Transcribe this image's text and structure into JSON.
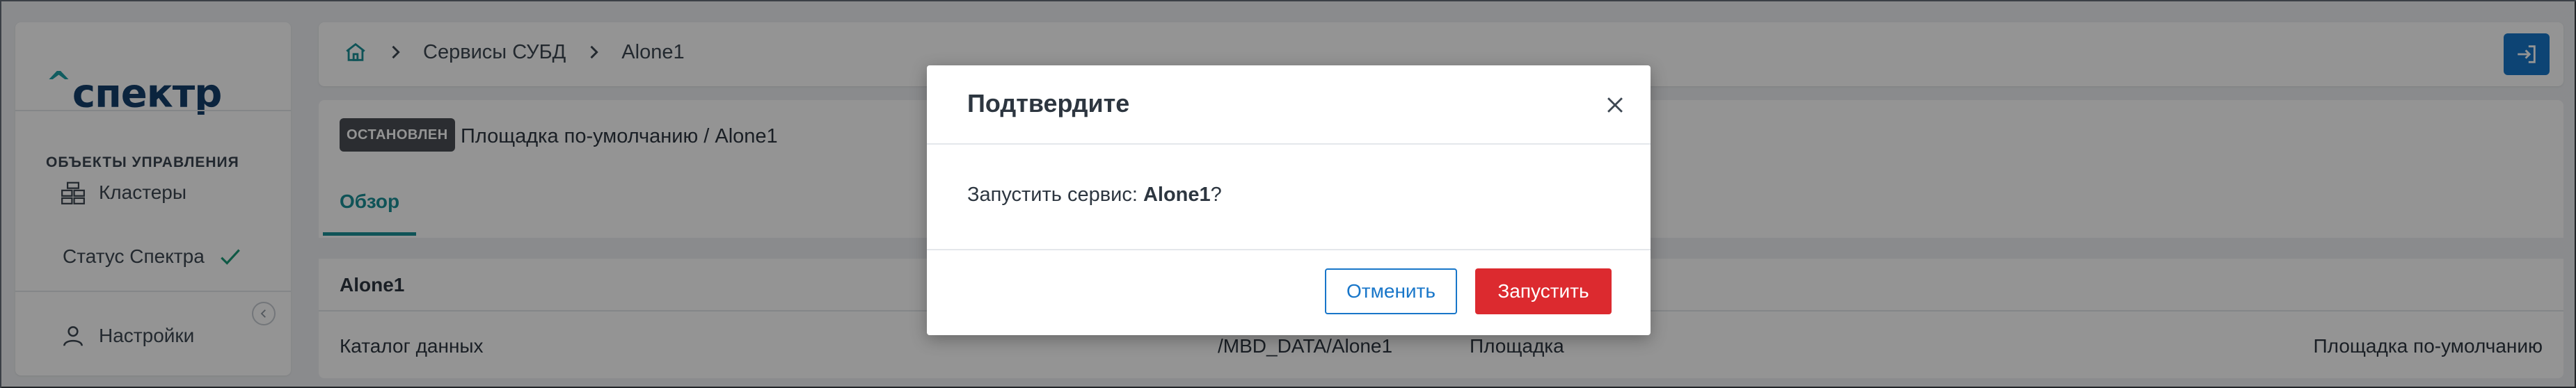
{
  "sidebar": {
    "logo_text": "спектр",
    "logo_mark": "^",
    "section_title": "ОБЪЕКТЫ УПРАВЛЕНИЯ",
    "items": [
      {
        "label": "Кластеры",
        "icon": "clusters-icon"
      },
      {
        "label": "Статус Спектра",
        "icon": "check-icon"
      },
      {
        "label": "Настройки",
        "icon": "user-icon"
      }
    ],
    "collapse_icon": "chevron-left-icon"
  },
  "topbar": {
    "breadcrumbs": [
      "Сервисы СУБД",
      "Alone1"
    ],
    "home_icon": "home-icon",
    "logout_icon": "logout-icon"
  },
  "service": {
    "status": "ОСТАНОВЛЕН",
    "title": "Площадка по-умолчанию /  Alone1",
    "tabs": [
      {
        "label": "Обзор",
        "active": true
      }
    ],
    "section_header": "Alone1",
    "row": {
      "label": "Каталог данных",
      "value": "/MBD_DATA/Alone1",
      "label2": "Площадка",
      "value2": "Площадка по-умолчанию"
    }
  },
  "modal": {
    "title": "Подтвердите",
    "body_prefix": "Запустить сервис: ",
    "body_name": "Alone1",
    "body_suffix": "?",
    "cancel_label": "Отменить",
    "confirm_label": "Запустить"
  },
  "colors": {
    "accent": "#1a8f96",
    "primary": "#1876c9",
    "danger": "#dc2a2f",
    "badge": "#4a4f55"
  }
}
